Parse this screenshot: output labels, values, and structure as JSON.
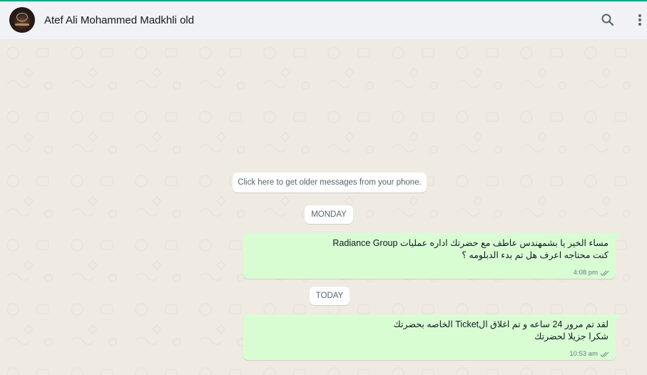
{
  "header": {
    "contact_name": "Atef Ali Mohammed Madkhli old",
    "avatar_icon": "contact-avatar",
    "search_icon": "search-icon",
    "menu_icon": "more-vertical-icon"
  },
  "chat": {
    "older_messages_notice": "Click here to get older messages from your phone.",
    "day_separators": [
      "MONDAY",
      "TODAY"
    ],
    "messages": [
      {
        "direction": "outgoing",
        "lines": [
          "مساء الخير يا بشمهندس عاطف مع حضرتك اداره عمليات Radiance Group",
          "كنت محتاجه اعرف هل تم بدء الدبلومه ؟"
        ],
        "time": "4:08 pm",
        "status_icon": "double-check-icon"
      },
      {
        "direction": "outgoing",
        "lines": [
          "لقد تم مرور 24 ساعه و تم اغلاق الTicket الخاصه بحضرتك",
          "شكرا جزيلا لحضرتك"
        ],
        "time": "10:53 am",
        "status_icon": "double-check-icon"
      }
    ]
  },
  "colors": {
    "accent": "#00a884",
    "header_bg": "#f0f2f5",
    "chat_bg": "#efeae2",
    "outgoing_bubble": "#d9fdd3",
    "text_primary": "#111b21",
    "text_secondary": "#667781"
  }
}
